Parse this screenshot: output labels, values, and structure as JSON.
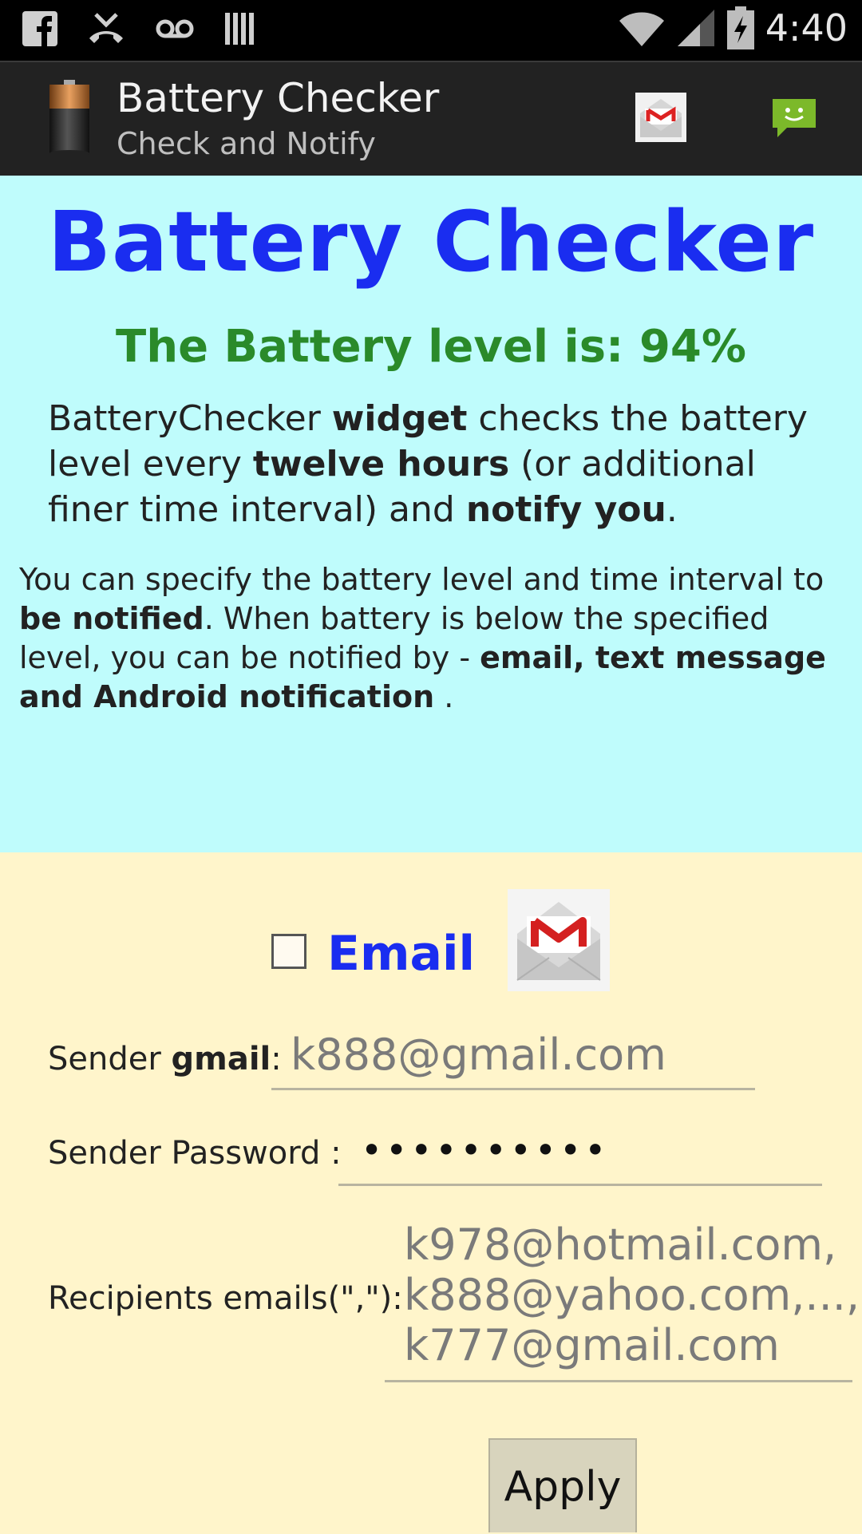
{
  "status_bar": {
    "time": "4:40",
    "left_icons": [
      "facebook-icon",
      "missed-call-icon",
      "voicemail-icon",
      "barcode-icon"
    ],
    "right_icons": [
      "wifi-icon",
      "signal-icon",
      "battery-charging-icon"
    ]
  },
  "action_bar": {
    "title": "Battery Checker",
    "subtitle": "Check and Notify",
    "actions": [
      "gmail-icon",
      "sms-icon"
    ]
  },
  "info": {
    "heading": "Battery Checker",
    "battery_level_text": "The Battery level is: 94%",
    "para1": {
      "t1": "BatteryChecker ",
      "b1": "widget",
      "t2": " checks the battery level every  ",
      "b2": "twelve hours",
      "t3": " (or additional finer time interval) and ",
      "b3": "notify you",
      "t4": "."
    },
    "para2": {
      "t1": " You can specify the battery level and time interval to ",
      "b1": "be notified",
      "t2": ". When battery is below the specified level, you can be notified by - ",
      "b2": "email, text message and Android notification",
      "t3": " ."
    },
    "colors": {
      "background": "#bffcfc",
      "heading": "#1a2df0",
      "level": "#2a8a2a"
    }
  },
  "email_section": {
    "checkbox_checked": false,
    "label": "Email",
    "sender_label_prefix": "Sender ",
    "sender_label_bold": "gmail",
    "sender_label_suffix": ":",
    "sender_hint": "k888@gmail.com",
    "password_label": "Sender Password :",
    "password_value": "••••••••••",
    "recipients_label": "Recipients emails(\",\"):",
    "recipients_hint_line1": "k978@hotmail.com,",
    "recipients_hint_line2": "k888@yahoo.com,...,",
    "recipients_hint_line3": "k777@gmail.com",
    "apply_label": "Apply",
    "colors": {
      "background": "#fff5cb"
    }
  }
}
